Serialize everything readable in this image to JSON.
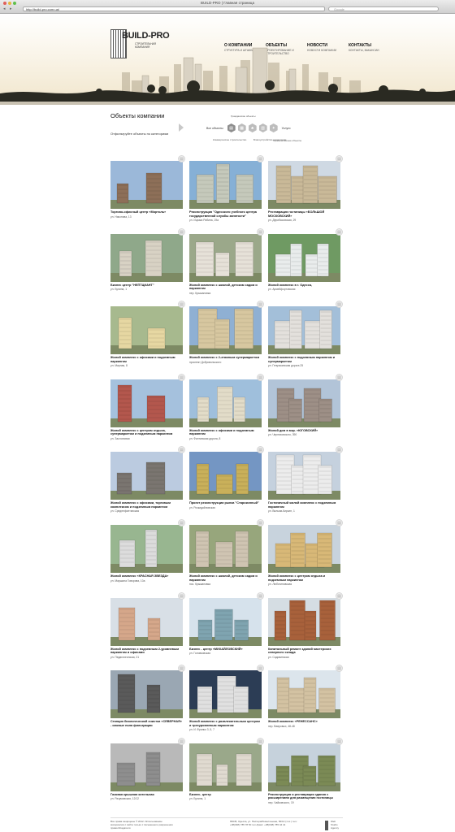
{
  "browser": {
    "title": "BUILD-PRO | Главная страница",
    "url": "http://build-pro.com.ua/",
    "search_placeholder": "Google"
  },
  "logo": {
    "name": "BUILD-PRO",
    "tagline": "СТРОИТЕЛЬНАЯ КОМПАНИЯ"
  },
  "nav": [
    {
      "title": "О КОМПАНИИ",
      "sub": "СТРУКТУРА И ШТАББЫ"
    },
    {
      "title": "ОБЪЕКТЫ",
      "sub": "ПРОЕКТИРОВАНИЕ И СТРОИТЕЛЬСТВО"
    },
    {
      "title": "НОВОСТИ",
      "sub": "НОВОСТИ КОМПАНИИ"
    },
    {
      "title": "КОНТАКТЫ",
      "sub": "КОНТАКТЫ, ВАКАНСИИ"
    }
  ],
  "section": {
    "title": "Объекты компании",
    "filter_label": "Отфильтруйте объекты по категориям"
  },
  "filters": {
    "all": "Все объекты",
    "other": "Услуги",
    "captions": [
      "Гражданские объекты",
      "Коммерческое строительство",
      "Благоустройство территории",
      "Промышленные объекты"
    ]
  },
  "objects": [
    {
      "title": "Торгово-офисный центр «Мортоль»",
      "address": "ул. Никонова, 13",
      "color": "#8d6f58",
      "sky": "#9bb8d9"
    },
    {
      "title": "Реконструкция \"Одесского учебного центра государственной службы занятости\"",
      "address": "ул. Ицхака Рабина, 19а",
      "color": "#c5c9bb",
      "sky": "#86b0d6"
    },
    {
      "title": "Реставрация гостиницы «БОЛЬШОЙ МОСКОВСКИЙ»",
      "address": "ул. Дерибасовская, 29",
      "color": "#c9b998",
      "sky": "#cfd9e3"
    },
    {
      "title": "Бизнес центр \"НЕПТЦИАНТ\"",
      "address": "ул. Бунина, 1",
      "color": "#d8d2c4",
      "sky": "#8fa88a"
    },
    {
      "title": "Жилой комплекс с школой, детским садом и паркингом",
      "address": "пер. Крыжановка",
      "color": "#e6e1d8",
      "sky": "#9ba88a"
    },
    {
      "title": "Жилой комплекс в г. Одесса,",
      "address": "ул. Армейфортовская",
      "color": "#e9ecec",
      "sky": "#6f9a63"
    },
    {
      "title": "Жилой комплекс с офисами и подземным паркингом",
      "address": "ул. Мирная, 8",
      "color": "#e6d7a2",
      "sky": "#a7b98e"
    },
    {
      "title": "Жилой комплекс с 2-этажным супермаркетом",
      "address": "проспект Добровольского",
      "color": "#d7c7a0",
      "sky": "#8fb0d3"
    },
    {
      "title": "Жилой комплекс с подземным паркингом и супермаркетом",
      "address": "ул. Генуэзкинская дорога 25",
      "color": "#e3e0dc",
      "sky": "#a3bfd9"
    },
    {
      "title": "Жилой комплекс с центром отдыха, супермаркетом и подземным паркингом",
      "address": "ул. Заслоновая",
      "color": "#b3574d",
      "sky": "#a5c1dd"
    },
    {
      "title": "Жилой комплекс с офисами и подземным паркингом",
      "address": "ул. Фонтанская дорога, 8",
      "color": "#e2dcc8",
      "sky": "#9fbfdc"
    },
    {
      "title": "Жилой дом в мкр. «ЮГОВСКИЙ»",
      "address": "ул. Черняховского, 390",
      "color": "#9d8f86",
      "sky": "#b2c4d8"
    },
    {
      "title": "Жилой комплекс с офисами, торговым комплексом и подземным паркингом",
      "address": "ул. Среднефонтанская",
      "color": "#7a7570",
      "sky": "#bbcbe0"
    },
    {
      "title": "Проект реконструкции рынка \"Староконный\"",
      "address": "ул. Розкидайловская",
      "color": "#c9b05a",
      "sky": "#7496c3"
    },
    {
      "title": "Гостиничный жилой комплекс с подземным паркингом",
      "address": "ул. Вильям-Кирьен, 1",
      "color": "#ececec",
      "sky": "#c5d1de"
    },
    {
      "title": "Жилой комплекс «КРАСНАЯ ЗВЕЗДА»",
      "address": "ул. Маршала Говорова, 10а",
      "color": "#dcdcdc",
      "sky": "#98b690"
    },
    {
      "title": "Жилой комплекс с школой, детским садом и паркингом",
      "address": "пос. Крыжановка",
      "color": "#cfc4b2",
      "sky": "#97a67c"
    },
    {
      "title": "Жилой комплекс с центром отдыха и подземным паркингом",
      "address": "ул. Люботиновская",
      "color": "#d8b877",
      "sky": "#c8d3dd"
    },
    {
      "title": "Жилой комплекс с подземным 2-уровневым паркингом и офисами",
      "address": "ул. Педагогическая, 21",
      "color": "#d5a78a",
      "sky": "#d8dfe6"
    },
    {
      "title": "Бизнес - центр «МИХАЙЛОВСКИЙ»",
      "address": "ул. Головковская",
      "color": "#7fa4b0",
      "sky": "#d6e2ec"
    },
    {
      "title": "Капитальный ремонт зданий мастерских северного склада",
      "address": "ул. Садовинская",
      "color": "#a8613b",
      "sky": "#d5dde3"
    },
    {
      "title": "Станция биологической очистки «СЕВЕРНАЯ» - иловые поля фильтрации",
      "address": "",
      "color": "#5a5a5a",
      "sky": "#9aa7b3"
    },
    {
      "title": "Жилой комплекс с развлекательным центром и трехуровневым паркингом",
      "address": "ул. И. Франко 3, 5, 7",
      "color": "#e0e0e0",
      "sky": "#2c3d55"
    },
    {
      "title": "Жилой комплекс «РЕНЕССАНС»",
      "address": "пер. Вавровых, 48-48",
      "color": "#d3c2a2",
      "sky": "#dce5ec"
    },
    {
      "title": "Газовая крышная котельная",
      "address": "ул. Разумовская, 12/12",
      "color": "#8e8e8e",
      "sky": "#b9b9b9"
    },
    {
      "title": "Бизнес- центр",
      "address": "ул. Бунина, 1",
      "color": "#e0dad0",
      "sky": "#9aa88a"
    },
    {
      "title": "Реконструкция и реставрация здания с расширением для размещения гостиницы",
      "address": "пер. Чайковского, 19",
      "color": "#7b8a55",
      "sky": "#c6d2dc"
    }
  ],
  "footer": {
    "left": "Все права защищены © 2012. Использование материалов с сайта только с письменного разрешения правообладателя",
    "mid": "65045, Одесса, ул. Пастера/Ремесленная, 56/13 (1 эт.)   тел.: +38(048) 785 78 50   тел./факс: +38(048) 785 44 41",
    "right": "Web Studio Agency"
  }
}
